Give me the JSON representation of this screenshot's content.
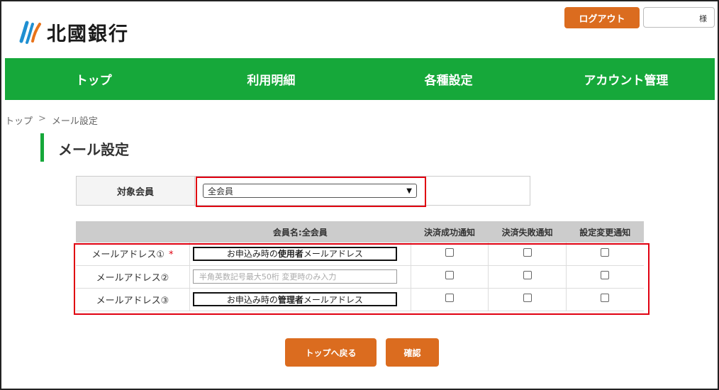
{
  "header": {
    "logo_text": "北國銀行",
    "logout_label": "ログアウト",
    "user_suffix": "様"
  },
  "nav": {
    "items": [
      {
        "label": "トップ"
      },
      {
        "label": "利用明細"
      },
      {
        "label": "各種設定"
      },
      {
        "label": "アカウント管理"
      }
    ]
  },
  "breadcrumb": {
    "home": "トップ",
    "separator": ">",
    "current": "メール設定"
  },
  "page_title": "メール設定",
  "target": {
    "label": "対象会員",
    "selected": "全会員"
  },
  "table": {
    "header_member": "会員名:全会員",
    "col_success": "決済成功通知",
    "col_failure": "決済失敗通知",
    "col_settings": "設定変更通知",
    "rows": [
      {
        "label": "メールアドレス①",
        "required_mark": "*",
        "value_prefix": "お申込み時の",
        "value_bold": "使用者",
        "value_suffix": "メールアドレス"
      },
      {
        "label": "メールアドレス②",
        "placeholder": "半角英数記号最大50桁 変更時のみ入力"
      },
      {
        "label": "メールアドレス③",
        "value_prefix": "お申込み時の",
        "value_bold": "管理者",
        "value_suffix": "メールアドレス"
      }
    ]
  },
  "buttons": {
    "back_label": "トップへ戻る",
    "confirm_label": "確認"
  },
  "colors": {
    "brand_green": "#16a83a",
    "button_orange": "#db6c1f",
    "highlight_red": "#e00010"
  }
}
